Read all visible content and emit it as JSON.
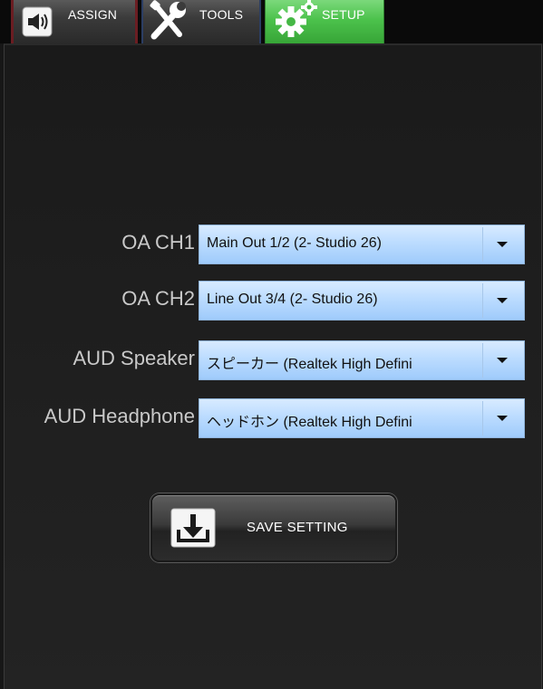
{
  "tabs": {
    "assign": {
      "label": "ASSIGN",
      "icon": "speaker-icon"
    },
    "tools": {
      "label": "TOOLS",
      "icon": "tools-icon"
    },
    "setup": {
      "label": "SETUP",
      "icon": "gears-icon",
      "active": true
    }
  },
  "settings": [
    {
      "label": "OA CH1",
      "value": "Main Out 1/2 (2- Studio 26)"
    },
    {
      "label": "OA CH2",
      "value": "Line Out 3/4 (2- Studio 26)"
    },
    {
      "label": "AUD Speaker",
      "value": "スピーカー (Realtek High Defini"
    },
    {
      "label": "AUD Headphone",
      "value": "ヘッドホン (Realtek High Defini"
    }
  ],
  "save_button": {
    "label": "SAVE SETTING",
    "icon": "save-download-icon"
  },
  "colors": {
    "active_tab": "#4cc24c",
    "dropdown_bg": "#bcdcff",
    "panel_bg": "#1e1e1e"
  }
}
